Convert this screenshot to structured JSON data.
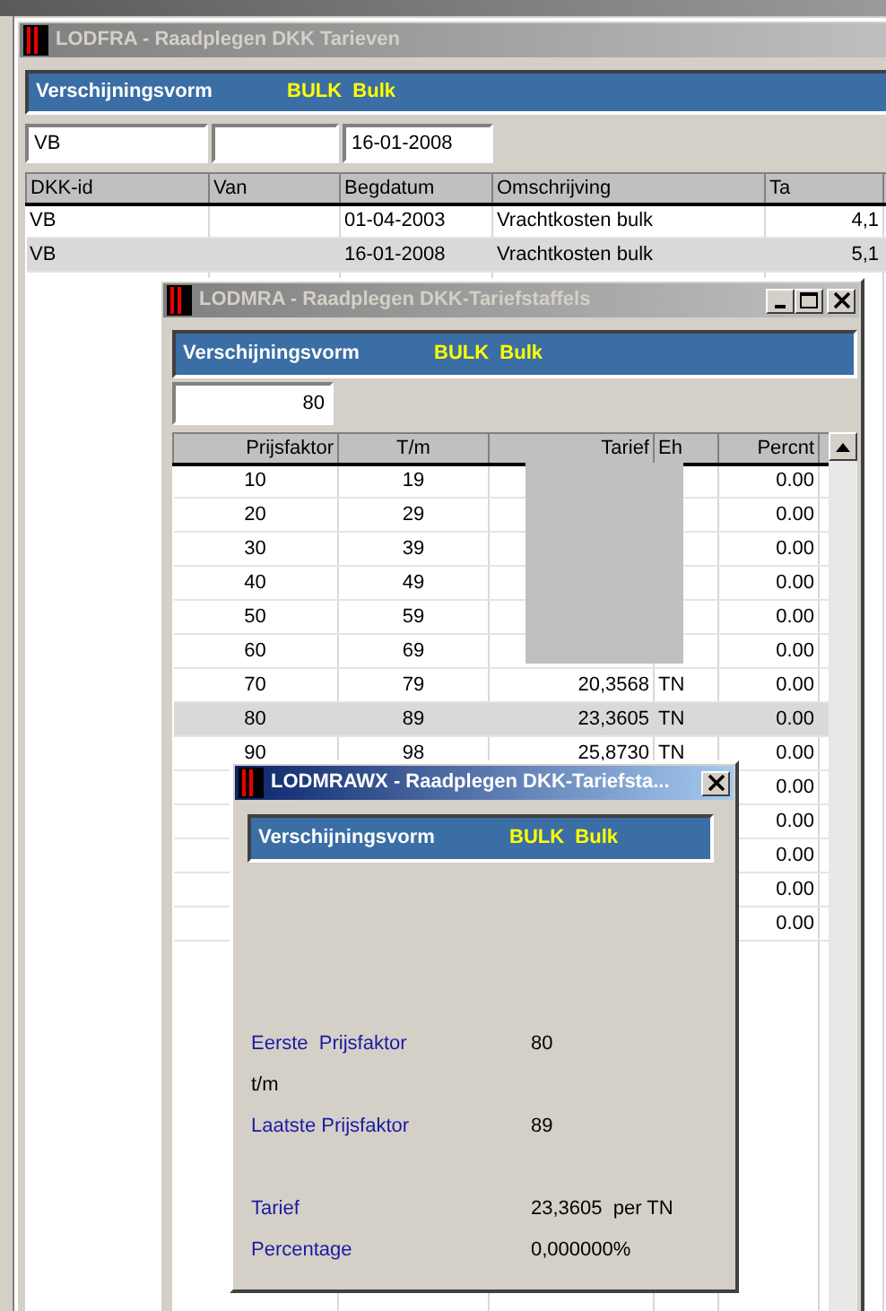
{
  "windows": [
    {
      "kind": "main",
      "title": "LODFRA - Raadplegen DKK Tarieven",
      "active": false,
      "header": {
        "label": "Verschijningsvorm",
        "value": "BULK  Bulk"
      },
      "fields": [
        {
          "value": "VB"
        },
        {
          "value": "16-01-2008"
        }
      ],
      "table": {
        "columns": [
          "DKK-id",
          "Van",
          "Begdatum",
          "Omschrijving",
          "Ta"
        ],
        "rows": [
          {
            "cells": [
              "VB",
              null,
              "01-04-2003",
              "Vrachtkosten bulk",
              "4,1"
            ],
            "selected": false
          },
          {
            "cells": [
              "VB",
              null,
              "16-01-2008",
              "Vrachtkosten bulk",
              "5,1"
            ],
            "selected": true
          }
        ]
      }
    },
    {
      "kind": "document",
      "title": "LODMRA - Raadplegen DKK-Tariefstaffels",
      "active": false,
      "header": {
        "label": "Verschijningsvorm",
        "value": "BULK  Bulk"
      },
      "fields": [
        {
          "value": "80"
        }
      ],
      "table": {
        "columns": [
          "Prijsfaktor",
          "T/m",
          "Tarief",
          "Eh",
          "Percnt"
        ],
        "rows": [
          {
            "cells": [
              "10",
              "19",
              null,
              null,
              "0.00"
            ],
            "selected": false
          },
          {
            "cells": [
              "20",
              "29",
              null,
              null,
              "0.00"
            ],
            "selected": false
          },
          {
            "cells": [
              "30",
              "39",
              null,
              null,
              "0.00"
            ],
            "selected": false
          },
          {
            "cells": [
              "40",
              "49",
              null,
              null,
              "0.00"
            ],
            "selected": false
          },
          {
            "cells": [
              "50",
              "59",
              null,
              null,
              "0.00"
            ],
            "selected": false
          },
          {
            "cells": [
              "60",
              "69",
              null,
              null,
              "0.00"
            ],
            "selected": false
          },
          {
            "cells": [
              "70",
              "79",
              "20,3568",
              "TN",
              "0.00"
            ],
            "selected": false
          },
          {
            "cells": [
              "80",
              "89",
              "23,3605",
              "TN",
              "0.00"
            ],
            "selected": true
          },
          {
            "cells": [
              "90",
              "98",
              "25,8730",
              "TN",
              "0.00"
            ],
            "selected": false
          },
          {
            "cells": [
              null,
              null,
              null,
              null,
              "0.00"
            ],
            "selected": false
          },
          {
            "cells": [
              null,
              null,
              null,
              null,
              "0.00"
            ],
            "selected": false
          },
          {
            "cells": [
              null,
              null,
              null,
              null,
              "0.00"
            ],
            "selected": false
          },
          {
            "cells": [
              null,
              null,
              null,
              null,
              "0.00"
            ],
            "selected": false
          },
          {
            "cells": [
              null,
              null,
              null,
              null,
              "0.00"
            ],
            "selected": false
          }
        ]
      }
    },
    {
      "kind": "dialog",
      "title": "LODMRAWX - Raadplegen DKK-Tariefsta...",
      "active": true,
      "header": {
        "label": "Verschijningsvorm",
        "value": "BULK  Bulk"
      },
      "details": [
        {
          "kind": "field",
          "label": "Eerste  Prijsfaktor",
          "value": "80"
        },
        {
          "kind": "note",
          "label": "t/m"
        },
        {
          "kind": "field",
          "label": "Laatste Prijsfaktor",
          "value": "89"
        },
        {
          "kind": "field",
          "label": "Tarief",
          "value": "23,3605  per TN"
        },
        {
          "kind": "field",
          "label": "Percentage",
          "value": "0,000000%"
        }
      ]
    }
  ]
}
